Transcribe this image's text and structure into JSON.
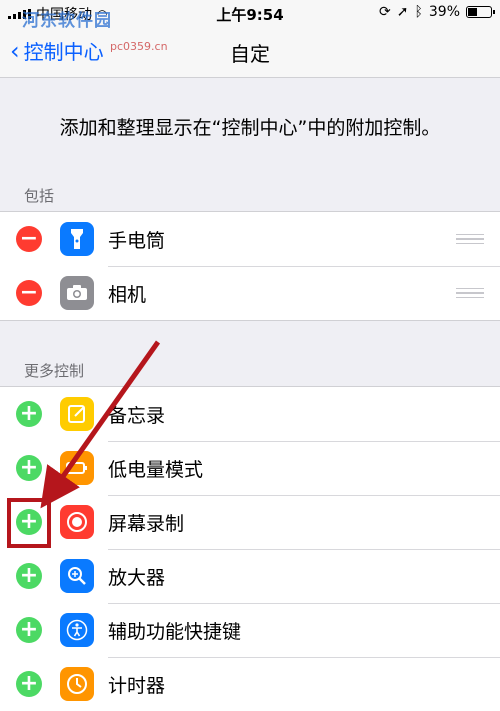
{
  "status_bar": {
    "carrier": "中国移动",
    "time": "上午9:54",
    "battery_text": "39%",
    "battery_level": 0.39
  },
  "watermark": {
    "text": "河东软件园",
    "url": "pc0359.cn"
  },
  "nav": {
    "back_label": "控制中心",
    "title": "自定"
  },
  "intro_text": "添加和整理显示在“控制中心”中的附加控制。",
  "included": {
    "header": "包括",
    "items": [
      {
        "label": "手电筒",
        "icon": "flashlight-icon",
        "color": "#0a7aff"
      },
      {
        "label": "相机",
        "icon": "camera-icon",
        "color": "#8e8e93"
      }
    ]
  },
  "more_controls": {
    "header": "更多控制",
    "items": [
      {
        "label": "备忘录",
        "icon": "notes-icon",
        "color": "#ffcc00"
      },
      {
        "label": "低电量模式",
        "icon": "battery-icon",
        "color": "#ff9500"
      },
      {
        "label": "屏幕录制",
        "icon": "screen-record-icon",
        "color": "#ff3b30"
      },
      {
        "label": "放大器",
        "icon": "magnifier-icon",
        "color": "#0a7aff"
      },
      {
        "label": "辅助功能快捷键",
        "icon": "accessibility-icon",
        "color": "#0a7aff"
      },
      {
        "label": "计时器",
        "icon": "timer-icon",
        "color": "#ff9500"
      }
    ]
  },
  "annotation": {
    "color": "#b5161c",
    "target": "屏幕录制"
  }
}
